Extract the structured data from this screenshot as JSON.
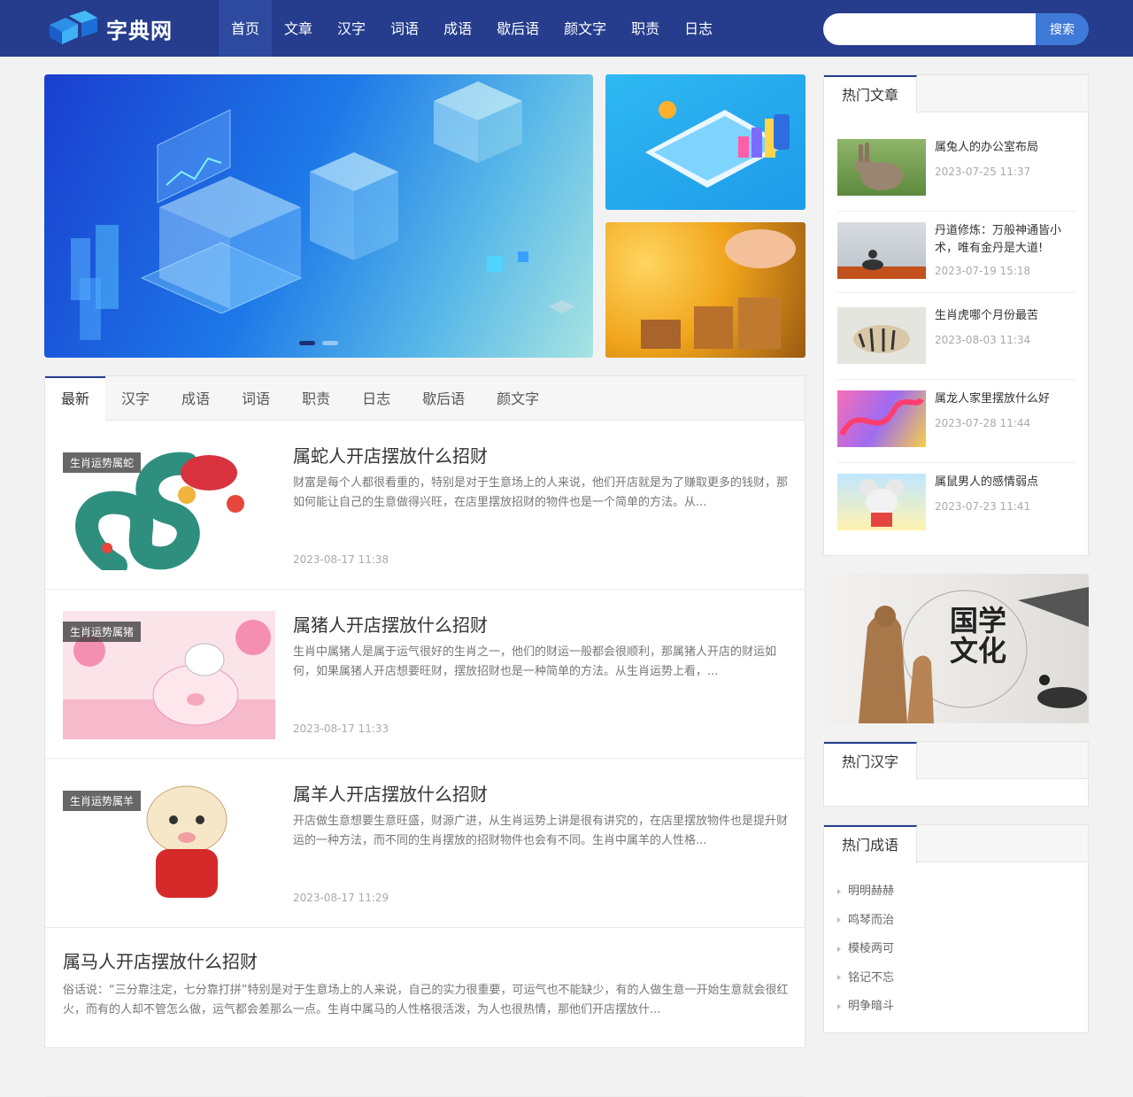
{
  "header": {
    "logo_text": "字典网",
    "nav": [
      "首页",
      "文章",
      "汉字",
      "词语",
      "成语",
      "歇后语",
      "颜文字",
      "职责",
      "日志"
    ],
    "search": {
      "placeholder": "",
      "button_label": "搜索"
    }
  },
  "slider": {
    "active_dot": 1,
    "dot_count": 2
  },
  "tabs": [
    "最新",
    "汉字",
    "成语",
    "词语",
    "职责",
    "日志",
    "歇后语",
    "颜文字"
  ],
  "articles": [
    {
      "badge": "生肖运势属蛇",
      "title": "属蛇人开店摆放什么招财",
      "desc": "财富是每个人都很看重的，特别是对于生意场上的人来说，他们开店就是为了赚取更多的钱财，那如何能让自己的生意做得兴旺，在店里摆放招财的物件也是一个简单的方法。从...",
      "date": "2023-08-17 11:38"
    },
    {
      "badge": "生肖运势属猪",
      "title": "属猪人开店摆放什么招财",
      "desc": "生肖中属猪人是属于运气很好的生肖之一，他们的财运一般都会很顺利，那属猪人开店的财运如何，如果属猪人开店想要旺财，摆放招财也是一种简单的方法。从生肖运势上看，...",
      "date": "2023-08-17 11:33"
    },
    {
      "badge": "生肖运势属羊",
      "title": "属羊人开店摆放什么招财",
      "desc": "开店做生意想要生意旺盛，财源广进，从生肖运势上讲是很有讲究的，在店里摆放物件也是提升财运的一种方法，而不同的生肖摆放的招财物件也会有不同。生肖中属羊的人性格...",
      "date": "2023-08-17 11:29"
    },
    {
      "title": "属马人开店摆放什么招财",
      "desc": "俗话说：“三分靠注定，七分靠打拼”特别是对于生意场上的人来说，自己的实力很重要，可运气也不能缺少，有的人做生意一开始生意就会很红火，而有的人却不管怎么做，运气都会差那么一点。生肖中属马的人性格很活泼，为人也很热情，那他们开店摆放什..."
    }
  ],
  "sidebar": {
    "hot_articles": {
      "heading": "热门文章",
      "items": [
        {
          "title": "属兔人的办公室布局",
          "date": "2023-07-25 11:37"
        },
        {
          "title": "丹道修炼：万般神通皆小术，唯有金丹是大道!",
          "date": "2023-07-19 15:18"
        },
        {
          "title": "生肖虎哪个月份最苦",
          "date": "2023-08-03 11:34"
        },
        {
          "title": "属龙人家里摆放什么好",
          "date": "2023-07-28 11:44"
        },
        {
          "title": "属鼠男人的感情弱点",
          "date": "2023-07-23 11:41"
        }
      ]
    },
    "banner": {
      "big_text": "国学文化"
    },
    "hot_chars": {
      "heading": "热门汉字"
    },
    "hot_idioms": {
      "heading": "热门成语",
      "items": [
        "明明赫赫",
        "鸣琴而治",
        "模棱两可",
        "铭记不忘",
        "明争暗斗"
      ]
    }
  },
  "colors": {
    "header_bg": "#253d8c",
    "accent": "#3f7ad9",
    "page_bg": "#f2f2f2"
  }
}
